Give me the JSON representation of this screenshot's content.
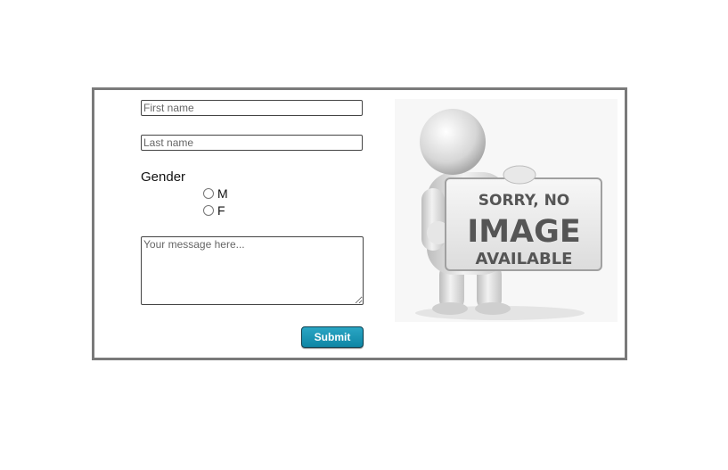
{
  "form": {
    "first_name_placeholder": "First name",
    "first_name_value": "",
    "last_name_placeholder": "Last name",
    "last_name_value": "",
    "gender_label": "Gender",
    "gender_options": [
      {
        "label": "M",
        "checked": false
      },
      {
        "label": "F",
        "checked": false
      }
    ],
    "message_placeholder": "Your message here...",
    "message_value": "",
    "submit_label": "Submit",
    "submit_color": "#1596b5"
  },
  "image": {
    "icon": "no-image-placeholder-figure",
    "line1": "SORRY, NO",
    "line2": "IMAGE",
    "line3": "AVAILABLE"
  },
  "colors": {
    "frame_border": "#7a7a7a",
    "sign_text": "#555555"
  }
}
